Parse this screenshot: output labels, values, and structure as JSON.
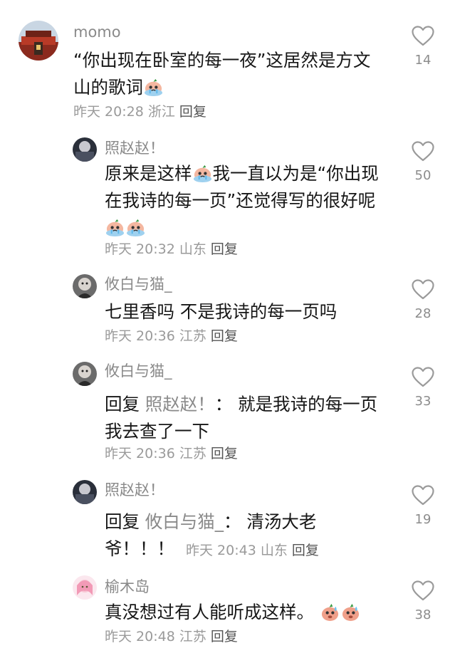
{
  "comments": [
    {
      "user": "momo",
      "text": "“你出现在卧室的每一夜”这居然是方文山的歌词",
      "time": "昨天 20:28",
      "location": "浙江",
      "reply_label": "回复",
      "likes": "14",
      "emoji": "crying-emoji"
    },
    {
      "user": "照赵赵！",
      "text_a": "原来是这样",
      "text_b": "我一直以为是“你出现在我诗的每一页”还觉得写的很好呢",
      "time": "昨天 20:32",
      "location": "山东",
      "reply_label": "回复",
      "likes": "50",
      "emoji": "crying-emoji"
    },
    {
      "user": "攸白与猫_",
      "text": "七里香吗 不是我诗的每一页吗",
      "time": "昨天 20:36",
      "location": "江苏",
      "reply_label": "回复",
      "likes": "28"
    },
    {
      "user": "攸白与猫_",
      "reply_prefix": "回复",
      "mention": "照赵赵！",
      "colon": "：",
      "text": "就是我诗的每一页 我去查了一下",
      "time": "昨天 20:36",
      "location": "江苏",
      "reply_label": "回复",
      "likes": "33"
    },
    {
      "user": "照赵赵！",
      "reply_prefix": "回复",
      "mention": "攸白与猫_",
      "colon": "：",
      "text": "清汤大老爷！！！",
      "time": "昨天 20:43",
      "location": "山东",
      "reply_label": "回复",
      "likes": "19"
    },
    {
      "user": "榆木岛",
      "text": "真没想过有人能听成这样。",
      "time": "昨天 20:48",
      "location": "江苏",
      "reply_label": "回复",
      "likes": "38",
      "emoji": "sweat-emoji"
    }
  ]
}
